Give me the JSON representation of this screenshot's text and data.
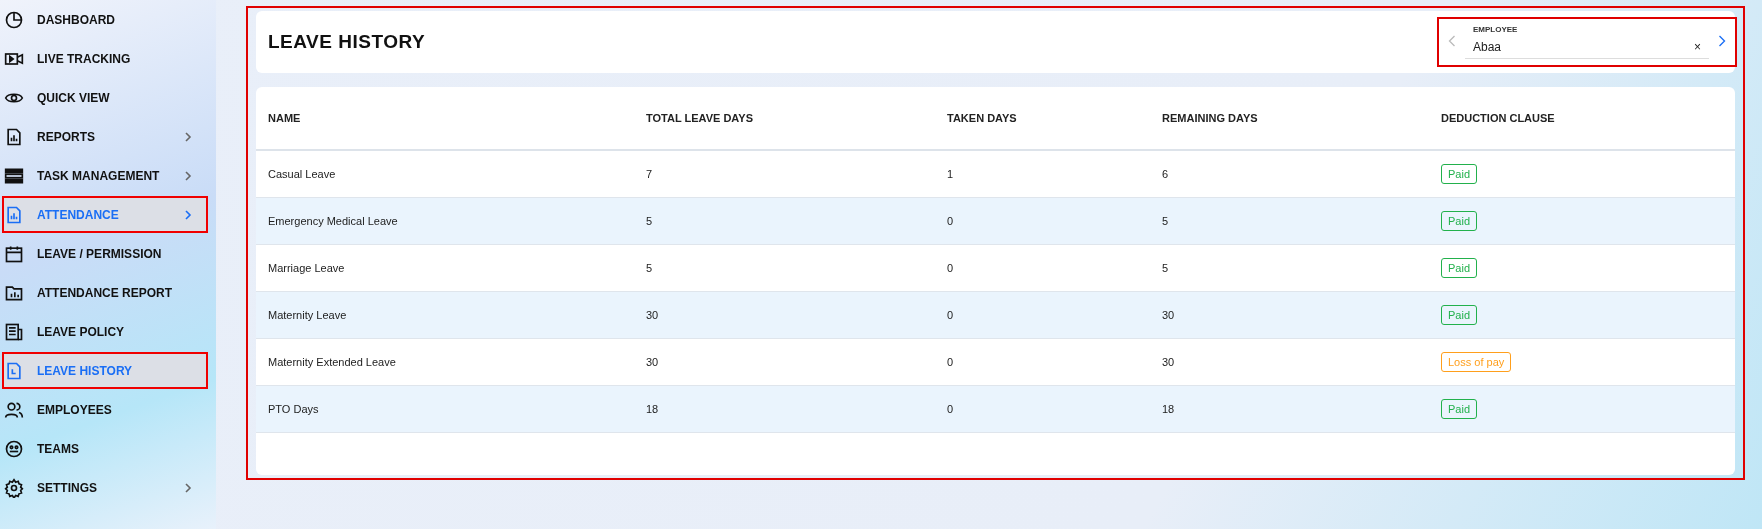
{
  "sidebar": {
    "items": [
      {
        "label": "DASHBOARD",
        "expandable": false,
        "highlighted": false
      },
      {
        "label": "LIVE TRACKING",
        "expandable": false,
        "highlighted": false
      },
      {
        "label": "QUICK VIEW",
        "expandable": false,
        "highlighted": false
      },
      {
        "label": "REPORTS",
        "expandable": true,
        "highlighted": false
      },
      {
        "label": "TASK MANAGEMENT",
        "expandable": true,
        "highlighted": false
      },
      {
        "label": "ATTENDANCE",
        "expandable": true,
        "highlighted": true
      },
      {
        "label": "LEAVE / PERMISSION",
        "expandable": false,
        "highlighted": false
      },
      {
        "label": "ATTENDANCE REPORT",
        "expandable": false,
        "highlighted": false
      },
      {
        "label": "LEAVE POLICY",
        "expandable": false,
        "highlighted": false
      },
      {
        "label": "LEAVE HISTORY",
        "expandable": false,
        "highlighted": true
      },
      {
        "label": "EMPLOYEES",
        "expandable": false,
        "highlighted": false
      },
      {
        "label": "TEAMS",
        "expandable": false,
        "highlighted": false
      },
      {
        "label": "SETTINGS",
        "expandable": true,
        "highlighted": false
      }
    ]
  },
  "header": {
    "title": "LEAVE HISTORY",
    "employee_field": {
      "label": "EMPLOYEE",
      "value": "Abaa",
      "clear": "×",
      "prev_disabled": true,
      "next_disabled": false
    }
  },
  "table": {
    "columns": [
      "NAME",
      "TOTAL LEAVE DAYS",
      "TAKEN DAYS",
      "REMAINING DAYS",
      "DEDUCTION CLAUSE"
    ],
    "rows": [
      {
        "name": "Casual Leave",
        "total": "7",
        "taken": "1",
        "remaining": "6",
        "deduction": "Paid",
        "color": "#22b14c"
      },
      {
        "name": "Emergency Medical Leave",
        "total": "5",
        "taken": "0",
        "remaining": "5",
        "deduction": "Paid",
        "color": "#22b14c"
      },
      {
        "name": "Marriage Leave",
        "total": "5",
        "taken": "0",
        "remaining": "5",
        "deduction": "Paid",
        "color": "#22b14c"
      },
      {
        "name": "Maternity Leave",
        "total": "30",
        "taken": "0",
        "remaining": "30",
        "deduction": "Paid",
        "color": "#22b14c"
      },
      {
        "name": "Maternity Extended Leave",
        "total": "30",
        "taken": "0",
        "remaining": "30",
        "deduction": "Loss of pay",
        "color": "#ff9f1c"
      },
      {
        "name": "PTO Days",
        "total": "18",
        "taken": "0",
        "remaining": "18",
        "deduction": "Paid",
        "color": "#22b14c"
      }
    ]
  }
}
